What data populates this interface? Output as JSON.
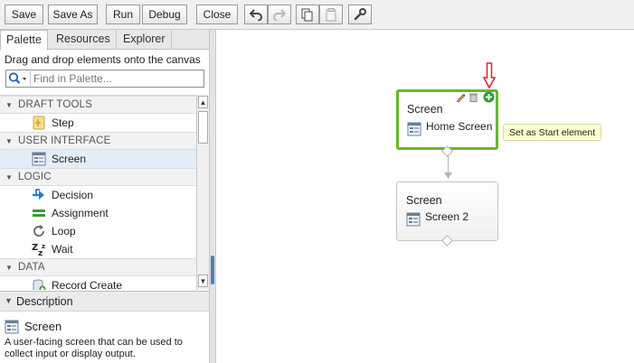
{
  "toolbar": {
    "save": "Save",
    "save_as": "Save As",
    "run": "Run",
    "debug": "Debug",
    "close": "Close",
    "icons": [
      "undo-icon",
      "redo-icon",
      "copy-icon",
      "paste-icon",
      "wrench-icon"
    ]
  },
  "left_panel": {
    "tabs": [
      "Palette",
      "Resources",
      "Explorer"
    ],
    "active_tab": "Palette",
    "hint": "Drag and drop elements onto the canvas",
    "search_placeholder": "Find in Palette...",
    "sections": [
      {
        "label": "DRAFT TOOLS",
        "items": [
          {
            "label": "Step",
            "icon": "step-icon"
          }
        ]
      },
      {
        "label": "USER INTERFACE",
        "items": [
          {
            "label": "Screen",
            "icon": "screen-icon",
            "selected": true
          }
        ]
      },
      {
        "label": "LOGIC",
        "items": [
          {
            "label": "Decision",
            "icon": "decision-icon"
          },
          {
            "label": "Assignment",
            "icon": "assignment-icon"
          },
          {
            "label": "Loop",
            "icon": "loop-icon"
          },
          {
            "label": "Wait",
            "icon": "wait-icon"
          }
        ]
      },
      {
        "label": "DATA",
        "items": [
          {
            "label": "Record Create",
            "icon": "record-create-icon"
          }
        ]
      }
    ],
    "description": {
      "header": "Description",
      "title": "Screen",
      "text": "A user-facing screen that can be used to collect input or display output."
    }
  },
  "canvas": {
    "nodes": [
      {
        "type": "Screen",
        "name": "Home Screen",
        "selected": true
      },
      {
        "type": "Screen",
        "name": "Screen 2",
        "selected": false
      }
    ],
    "tooltip": "Set as Start element"
  },
  "colors": {
    "selection_green": "#6bb52a",
    "arrow_red": "#d9232a",
    "start_green": "#2e9e3a",
    "tooltip_bg": "#ffffd2"
  }
}
